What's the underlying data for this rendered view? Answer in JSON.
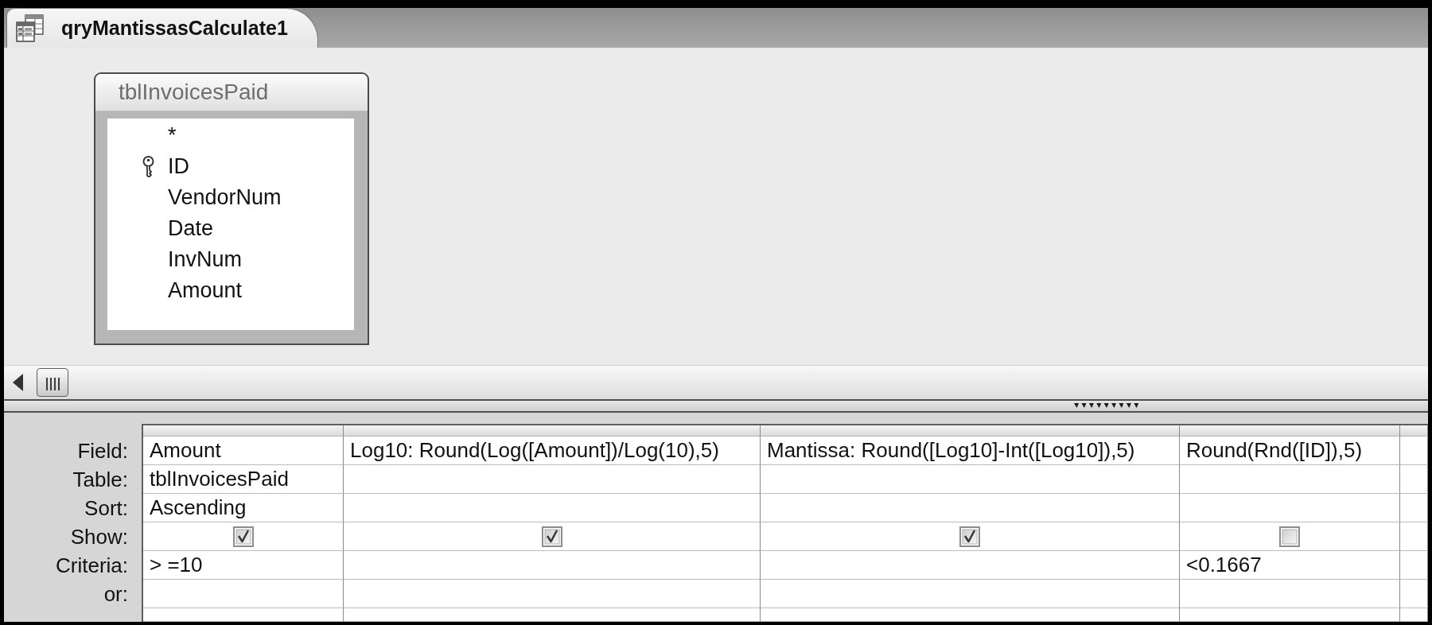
{
  "document_tab": {
    "title": "qryMantissasCalculate1",
    "selected": true
  },
  "table_window": {
    "title": "tblInvoicesPaid",
    "fields": [
      {
        "name": "*",
        "primary_key": false
      },
      {
        "name": "ID",
        "primary_key": true
      },
      {
        "name": "VendorNum",
        "primary_key": false
      },
      {
        "name": "Date",
        "primary_key": false
      },
      {
        "name": "InvNum",
        "primary_key": false
      },
      {
        "name": "Amount",
        "primary_key": false
      }
    ]
  },
  "design_grid": {
    "row_labels": [
      "Field:",
      "Table:",
      "Sort:",
      "Show:",
      "Criteria:",
      "or:"
    ],
    "columns": [
      {
        "field": "Amount",
        "table": "tblInvoicesPaid",
        "sort": "Ascending",
        "show": true,
        "criteria": "> =10"
      },
      {
        "field": "Log10: Round(Log([Amount])/Log(10),5)",
        "show": true
      },
      {
        "field": "Mantissa: Round([Log10]-Int([Log10]),5)",
        "show": true
      },
      {
        "field": "Round(Rnd([ID]),5)",
        "show": false,
        "criteria": "<0.1667"
      }
    ]
  }
}
